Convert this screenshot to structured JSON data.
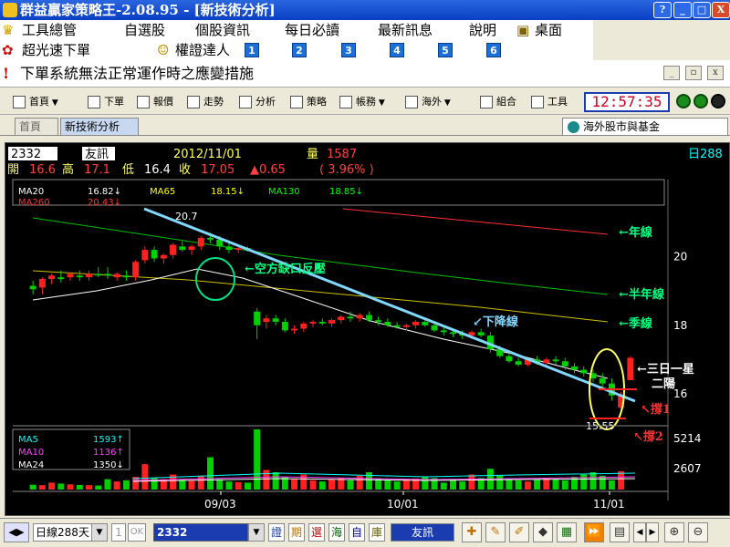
{
  "window": {
    "title": "群益贏家策略王-2.08.95 - [新技術分析]",
    "btn_help": "?",
    "btn_min": "_",
    "btn_max": "□",
    "btn_close": "X"
  },
  "menu": {
    "items": [
      "工具總管",
      "自選股",
      "個股資訊",
      "每日必讀",
      "最新訊息",
      "說明",
      "桌面"
    ]
  },
  "quicklinks": {
    "fast_order": "超光速下單",
    "warrant": "權證達人",
    "numbers": [
      "1",
      "2",
      "3",
      "4",
      "5",
      "6"
    ]
  },
  "notice": {
    "text": "下單系統無法正常運作時之應變措施",
    "mdi_min": "_",
    "mdi_restore": "▫",
    "mdi_close": "x"
  },
  "toolbar": {
    "items": [
      "首頁",
      "下單",
      "報價",
      "走勢",
      "分析",
      "策略",
      "帳務",
      "海外",
      "組合",
      "工具"
    ],
    "clock": "12:57:35"
  },
  "tabs": {
    "home": "首頁",
    "active": "新技術分析",
    "overseas": "海外股市與基金"
  },
  "quote": {
    "symbol": "2332",
    "name": "友訊",
    "date": "2012/11/01",
    "volume_label": "量",
    "volume": "1587",
    "period": "日288",
    "open_label": "開",
    "open": "16.6",
    "high_label": "高",
    "high": "17.1",
    "low_label": "低",
    "low": "16.4",
    "close_label": "收",
    "close": "17.05",
    "change": "▲0.65",
    "change_pct": "( 3.96% )"
  },
  "ma_legend": [
    {
      "name": "MA20",
      "value": "16.82↓",
      "color": "#ffffff"
    },
    {
      "name": "MA65",
      "value": "18.15↓",
      "color": "#ffff00"
    },
    {
      "name": "MA130",
      "value": "18.85↓",
      "color": "#00ff00"
    },
    {
      "name": "MA260",
      "value": "20.43↓",
      "color": "#ff3030"
    }
  ],
  "vol_legend": [
    {
      "name": "MA5",
      "value": "1593↑",
      "color": "#00ffff"
    },
    {
      "name": "MA10",
      "value": "1136↑",
      "color": "#ff40ff"
    },
    {
      "name": "MA24",
      "value": "1350↓",
      "color": "#ffffff"
    }
  ],
  "annotations": {
    "gap_resistance": "←空方缺口反壓",
    "yearline": "←年線",
    "halfyearline": "←半年線",
    "seasonline": "←季線",
    "downtrend": "下降線",
    "star": "←三日一星",
    "two_sun": "二陽",
    "support1": "撐1",
    "support2": "撐2",
    "high_mark": "20.7",
    "low_mark": "15.55"
  },
  "chart_data": {
    "type": "candlestick",
    "price_axis_ticks": [
      "20",
      "18",
      "16"
    ],
    "price_range": [
      15.2,
      21.4
    ],
    "volume_axis_ticks": [
      "5214",
      "2607"
    ],
    "date_ticks": [
      "09/03",
      "10/01",
      "11/01"
    ],
    "candles": [
      {
        "o": 19.15,
        "h": 19.3,
        "l": 18.9,
        "c": 19.05
      },
      {
        "o": 19.1,
        "h": 19.4,
        "l": 18.9,
        "c": 19.35
      },
      {
        "o": 19.35,
        "h": 19.5,
        "l": 19.2,
        "c": 19.45
      },
      {
        "o": 19.4,
        "h": 19.6,
        "l": 19.25,
        "c": 19.35
      },
      {
        "o": 19.4,
        "h": 19.55,
        "l": 19.3,
        "c": 19.5
      },
      {
        "o": 19.45,
        "h": 19.6,
        "l": 19.3,
        "c": 19.4
      },
      {
        "o": 19.4,
        "h": 19.6,
        "l": 19.3,
        "c": 19.5
      },
      {
        "o": 19.5,
        "h": 19.7,
        "l": 19.4,
        "c": 19.45
      },
      {
        "o": 19.5,
        "h": 19.7,
        "l": 19.35,
        "c": 19.45
      },
      {
        "o": 19.4,
        "h": 19.55,
        "l": 19.3,
        "c": 19.5
      },
      {
        "o": 19.45,
        "h": 19.6,
        "l": 19.3,
        "c": 19.4
      },
      {
        "o": 19.4,
        "h": 19.9,
        "l": 19.3,
        "c": 19.85
      },
      {
        "o": 19.9,
        "h": 20.3,
        "l": 19.8,
        "c": 20.2
      },
      {
        "o": 20.2,
        "h": 20.3,
        "l": 19.85,
        "c": 19.95
      },
      {
        "o": 19.95,
        "h": 20.1,
        "l": 19.8,
        "c": 20.05
      },
      {
        "o": 20.05,
        "h": 20.4,
        "l": 19.95,
        "c": 20.35
      },
      {
        "o": 20.3,
        "h": 20.45,
        "l": 20.15,
        "c": 20.2
      },
      {
        "o": 20.2,
        "h": 20.35,
        "l": 20.05,
        "c": 20.3
      },
      {
        "o": 20.3,
        "h": 20.6,
        "l": 20.2,
        "c": 20.55
      },
      {
        "o": 20.55,
        "h": 20.7,
        "l": 20.4,
        "c": 20.5
      },
      {
        "o": 20.5,
        "h": 20.6,
        "l": 20.2,
        "c": 20.3
      },
      {
        "o": 20.3,
        "h": 20.4,
        "l": 20.1,
        "c": 20.2
      },
      {
        "o": 20.2,
        "h": 20.3,
        "l": 20.1,
        "c": 20.25
      },
      {
        "o": 20.25,
        "h": 20.3,
        "l": 20.15,
        "c": 20.2
      },
      {
        "o": 18.4,
        "h": 18.5,
        "l": 17.6,
        "c": 18.0
      },
      {
        "o": 18.1,
        "h": 18.3,
        "l": 17.9,
        "c": 18.2
      },
      {
        "o": 18.2,
        "h": 18.3,
        "l": 18.0,
        "c": 18.1
      },
      {
        "o": 18.1,
        "h": 18.2,
        "l": 17.8,
        "c": 17.85
      },
      {
        "o": 17.85,
        "h": 18.0,
        "l": 17.75,
        "c": 17.9
      },
      {
        "o": 17.9,
        "h": 18.1,
        "l": 17.8,
        "c": 18.05
      },
      {
        "o": 18.05,
        "h": 18.15,
        "l": 17.95,
        "c": 18.1
      },
      {
        "o": 18.1,
        "h": 18.2,
        "l": 18.0,
        "c": 18.05
      },
      {
        "o": 18.05,
        "h": 18.2,
        "l": 17.95,
        "c": 18.15
      },
      {
        "o": 18.15,
        "h": 18.3,
        "l": 18.05,
        "c": 18.25
      },
      {
        "o": 18.25,
        "h": 18.4,
        "l": 18.1,
        "c": 18.2
      },
      {
        "o": 18.2,
        "h": 18.35,
        "l": 18.1,
        "c": 18.3
      },
      {
        "o": 18.3,
        "h": 18.4,
        "l": 18.1,
        "c": 18.15
      },
      {
        "o": 18.15,
        "h": 18.25,
        "l": 18.0,
        "c": 18.1
      },
      {
        "o": 18.1,
        "h": 18.2,
        "l": 17.95,
        "c": 18.0
      },
      {
        "o": 18.0,
        "h": 18.1,
        "l": 17.9,
        "c": 17.95
      },
      {
        "o": 17.95,
        "h": 18.05,
        "l": 17.85,
        "c": 18.0
      },
      {
        "o": 18.0,
        "h": 18.15,
        "l": 17.9,
        "c": 18.1
      },
      {
        "o": 18.1,
        "h": 18.2,
        "l": 17.95,
        "c": 18.0
      },
      {
        "o": 18.0,
        "h": 18.1,
        "l": 17.8,
        "c": 17.85
      },
      {
        "o": 17.85,
        "h": 17.95,
        "l": 17.7,
        "c": 17.8
      },
      {
        "o": 17.8,
        "h": 17.9,
        "l": 17.65,
        "c": 17.75
      },
      {
        "o": 17.75,
        "h": 17.85,
        "l": 17.6,
        "c": 17.7
      },
      {
        "o": 17.7,
        "h": 17.85,
        "l": 17.6,
        "c": 17.8
      },
      {
        "o": 17.8,
        "h": 17.9,
        "l": 17.65,
        "c": 17.7
      },
      {
        "o": 17.7,
        "h": 17.8,
        "l": 17.2,
        "c": 17.3
      },
      {
        "o": 17.3,
        "h": 17.4,
        "l": 17.05,
        "c": 17.1
      },
      {
        "o": 17.1,
        "h": 17.2,
        "l": 16.9,
        "c": 16.95
      },
      {
        "o": 16.95,
        "h": 17.05,
        "l": 16.8,
        "c": 16.85
      },
      {
        "o": 16.85,
        "h": 17.05,
        "l": 16.8,
        "c": 17.0
      },
      {
        "o": 17.0,
        "h": 17.1,
        "l": 16.85,
        "c": 16.9
      },
      {
        "o": 16.9,
        "h": 17.05,
        "l": 16.8,
        "c": 17.0
      },
      {
        "o": 17.0,
        "h": 17.1,
        "l": 16.85,
        "c": 16.95
      },
      {
        "o": 16.95,
        "h": 17.05,
        "l": 16.7,
        "c": 16.8
      },
      {
        "o": 16.8,
        "h": 16.9,
        "l": 16.6,
        "c": 16.7
      },
      {
        "o": 16.7,
        "h": 16.8,
        "l": 16.5,
        "c": 16.6
      },
      {
        "o": 16.6,
        "h": 16.7,
        "l": 16.35,
        "c": 16.45
      },
      {
        "o": 16.45,
        "h": 16.6,
        "l": 16.2,
        "c": 16.3
      },
      {
        "o": 16.3,
        "h": 16.45,
        "l": 15.8,
        "c": 15.95
      },
      {
        "o": 15.6,
        "h": 16.05,
        "l": 15.55,
        "c": 15.95
      },
      {
        "o": 16.4,
        "h": 17.1,
        "l": 16.4,
        "c": 17.05
      }
    ],
    "volumes": [
      420,
      380,
      600,
      520,
      450,
      400,
      380,
      350,
      900,
      700,
      800,
      1100,
      2200,
      1000,
      900,
      1300,
      850,
      760,
      1200,
      2800,
      900,
      700,
      650,
      600,
      5214,
      1700,
      1500,
      1100,
      900,
      1300,
      800,
      700,
      900,
      1000,
      800,
      1200,
      1500,
      900,
      800,
      700,
      850,
      950,
      1100,
      1000,
      600,
      900,
      700,
      1300,
      1000,
      1800,
      1200,
      900,
      800,
      700,
      900,
      1000,
      900,
      800,
      1100,
      1300,
      1500,
      1200,
      800,
      1587
    ],
    "series": [
      {
        "name": "MA20",
        "color": "#ffffff"
      },
      {
        "name": "MA65",
        "color": "#ffff00"
      },
      {
        "name": "MA130",
        "color": "#00ff00"
      },
      {
        "name": "MA260",
        "color": "#ff3030"
      }
    ]
  },
  "bottom": {
    "period": "日線288天",
    "stepper": "1",
    "ok": "OK",
    "symbol": "2332",
    "name": "友訊",
    "quick": [
      "證",
      "期",
      "選",
      "海",
      "自",
      "庫"
    ]
  }
}
